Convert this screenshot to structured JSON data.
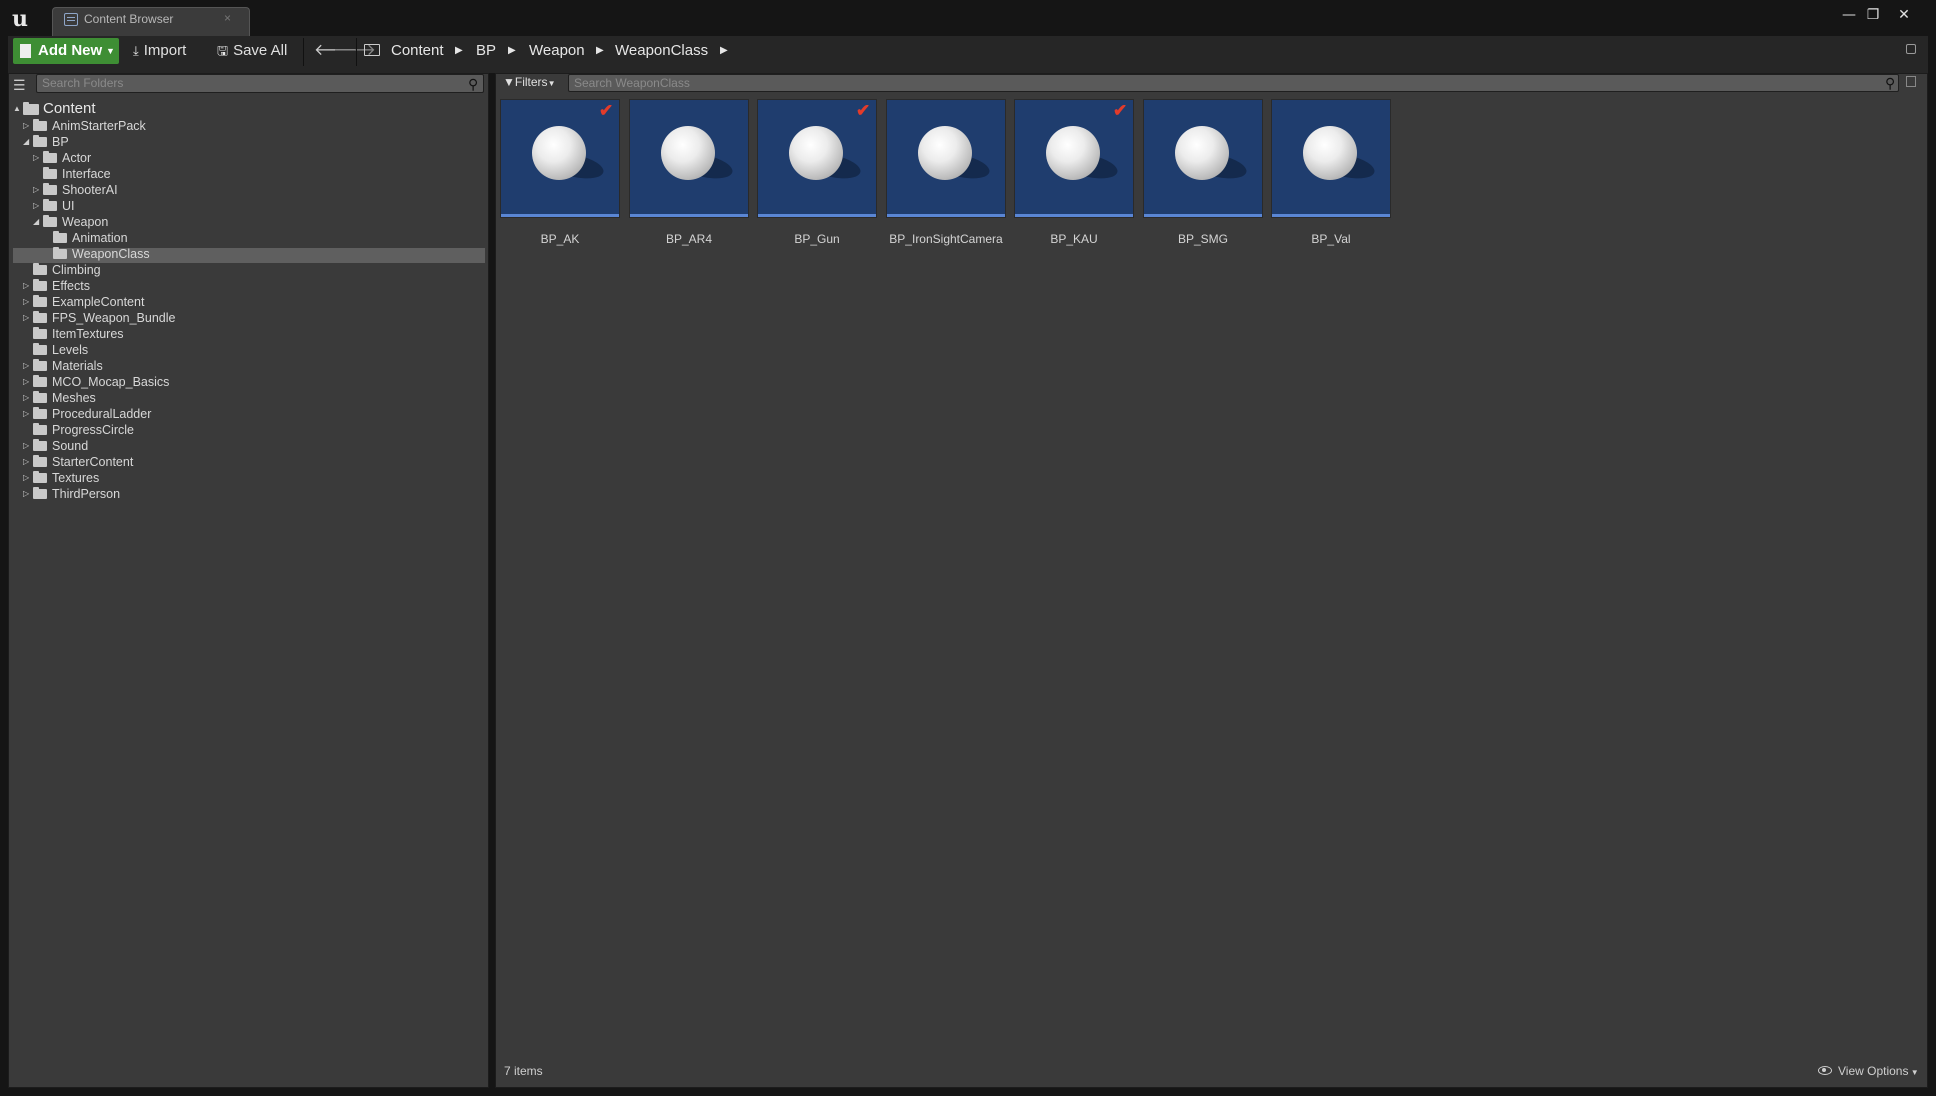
{
  "window": {
    "tab_label": "Content Browser",
    "tab_close": "×",
    "minimize": "—",
    "restore": "❐",
    "close": "✕"
  },
  "toolbar": {
    "add_new": "Add New",
    "import": "Import",
    "save_all": "Save All"
  },
  "breadcrumbs": [
    "Content",
    "BP",
    "Weapon",
    "WeaponClass"
  ],
  "folder_search": {
    "placeholder": "Search Folders"
  },
  "folder_tree": [
    {
      "label": "Content",
      "expander": "▲",
      "level": 0
    },
    {
      "label": "AnimStarterPack",
      "expander": "▷",
      "level": 1
    },
    {
      "label": "BP",
      "expander": "◢",
      "level": 1
    },
    {
      "label": "Actor",
      "expander": "▷",
      "level": 2
    },
    {
      "label": "Interface",
      "expander": "",
      "level": 2
    },
    {
      "label": "ShooterAI",
      "expander": "▷",
      "level": 2
    },
    {
      "label": "UI",
      "expander": "▷",
      "level": 2
    },
    {
      "label": "Weapon",
      "expander": "◢",
      "level": 2
    },
    {
      "label": "Animation",
      "expander": "",
      "level": 3
    },
    {
      "label": "WeaponClass",
      "expander": "",
      "level": 3,
      "selected": true
    },
    {
      "label": "Climbing",
      "expander": "",
      "level": 1
    },
    {
      "label": "Effects",
      "expander": "▷",
      "level": 1
    },
    {
      "label": "ExampleContent",
      "expander": "▷",
      "level": 1
    },
    {
      "label": "FPS_Weapon_Bundle",
      "expander": "▷",
      "level": 1
    },
    {
      "label": "ItemTextures",
      "expander": "",
      "level": 1
    },
    {
      "label": "Levels",
      "expander": "",
      "level": 1
    },
    {
      "label": "Materials",
      "expander": "▷",
      "level": 1
    },
    {
      "label": "MCO_Mocap_Basics",
      "expander": "▷",
      "level": 1
    },
    {
      "label": "Meshes",
      "expander": "▷",
      "level": 1
    },
    {
      "label": "ProceduralLadder",
      "expander": "▷",
      "level": 1
    },
    {
      "label": "ProgressCircle",
      "expander": "",
      "level": 1
    },
    {
      "label": "Sound",
      "expander": "▷",
      "level": 1
    },
    {
      "label": "StarterContent",
      "expander": "▷",
      "level": 1
    },
    {
      "label": "Textures",
      "expander": "▷",
      "level": 1
    },
    {
      "label": "ThirdPerson",
      "expander": "▷",
      "level": 1
    }
  ],
  "filters_label": "Filters",
  "asset_search": {
    "placeholder": "Search WeaponClass"
  },
  "assets": [
    {
      "name": "BP_AK",
      "checked": true
    },
    {
      "name": "BP_AR4",
      "checked": false
    },
    {
      "name": "BP_Gun",
      "checked": true
    },
    {
      "name": "BP_IronSightCamera",
      "checked": false
    },
    {
      "name": "BP_KAU",
      "checked": true
    },
    {
      "name": "BP_SMG",
      "checked": false
    },
    {
      "name": "BP_Val",
      "checked": false
    }
  ],
  "status": {
    "item_count": "7 items",
    "view_options": "View Options"
  },
  "colors": {
    "tile_bg": "#1f3d6e",
    "tile_bar": "#5a86d4",
    "checkmark": "#e33b2a",
    "add_new_bg": "#3e8e34"
  }
}
